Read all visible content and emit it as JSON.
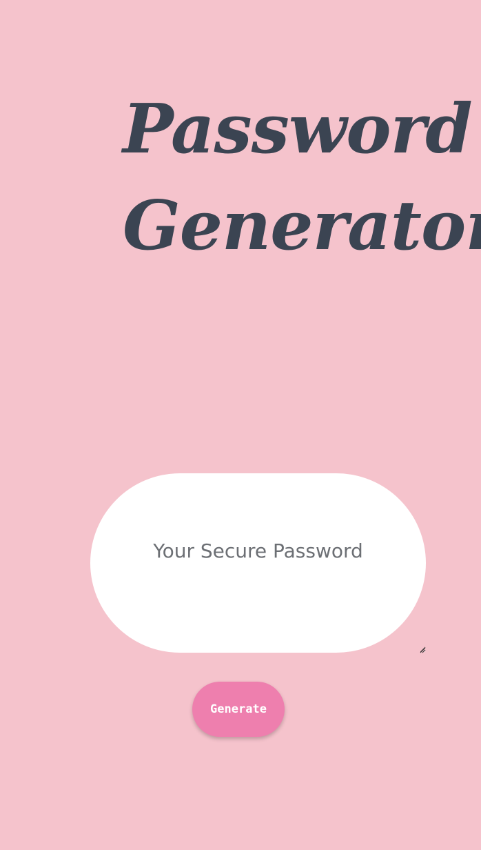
{
  "page": {
    "title_line_1": "Password",
    "title_line_2": "Generator"
  },
  "password_field": {
    "placeholder": "Your Secure Password",
    "value": ""
  },
  "generate_button": {
    "label": "Generate"
  },
  "colors": {
    "background": "#f5c3cc",
    "title_text": "#3b4452",
    "field_background": "#ffffff",
    "button_background": "#ee7fae",
    "button_text": "#ffffff"
  }
}
